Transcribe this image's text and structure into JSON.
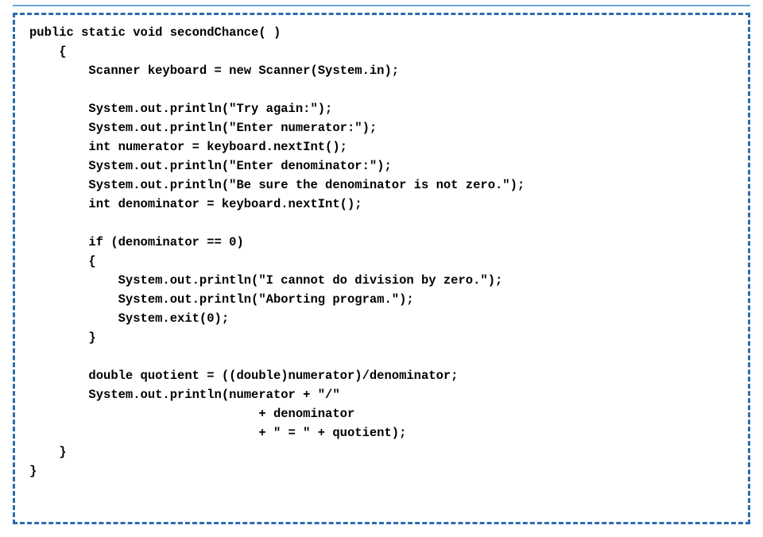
{
  "code": "public static void secondChance( )\n    {\n        Scanner keyboard = new Scanner(System.in);\n\n        System.out.println(\"Try again:\");\n        System.out.println(\"Enter numerator:\");\n        int numerator = keyboard.nextInt();\n        System.out.println(\"Enter denominator:\");\n        System.out.println(\"Be sure the denominator is not zero.\");\n        int denominator = keyboard.nextInt();\n\n        if (denominator == 0)\n        {\n            System.out.println(\"I cannot do division by zero.\");\n            System.out.println(\"Aborting program.\");\n            System.exit(0);\n        }\n\n        double quotient = ((double)numerator)/denominator;\n        System.out.println(numerator + \"/\"\n                               + denominator\n                               + \" = \" + quotient);\n    }\n}"
}
